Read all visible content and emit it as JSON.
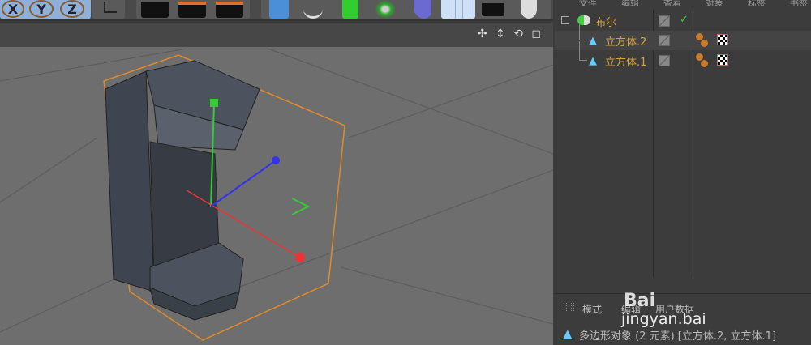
{
  "toolbar": {
    "axis_buttons": [
      "X",
      "Y",
      "Z"
    ],
    "icons": [
      "coordinate-system-icon",
      "render-view-icon",
      "render-picture-icon",
      "render-settings-icon",
      "cube-icon",
      "spline-pen-icon",
      "subdivision-icon",
      "cloner-icon",
      "deformer-icon",
      "floor-icon",
      "camera-icon",
      "light-icon"
    ]
  },
  "viewport": {
    "nav_icons": [
      "move-view-icon",
      "zoom-view-icon",
      "rotate-view-icon",
      "maximize-view-icon"
    ],
    "nav_text": "✣ ↕ ⟲ ◻"
  },
  "object_manager": {
    "menu": [
      "文件",
      "编辑",
      "查看",
      "对象",
      "标签",
      "书签"
    ],
    "objects": [
      {
        "name": "布尔",
        "icon": "boolean-icon",
        "check": "✓"
      },
      {
        "name": "立方体.2",
        "icon": "polygon-object-icon"
      },
      {
        "name": "立方体.1",
        "icon": "polygon-object-icon"
      }
    ]
  },
  "attributes": {
    "tabs": [
      "模式",
      "编辑",
      "用户数据"
    ],
    "status": "多边形对象 (2 元素) [立方体.2, 立方体.1]"
  },
  "watermark": {
    "line1": "Bai",
    "line2": "jingyan.bai"
  },
  "colors": {
    "object_name": "#d8a33c",
    "viewport_bg": "#6e6e6e",
    "selection": "#e08a2a"
  }
}
